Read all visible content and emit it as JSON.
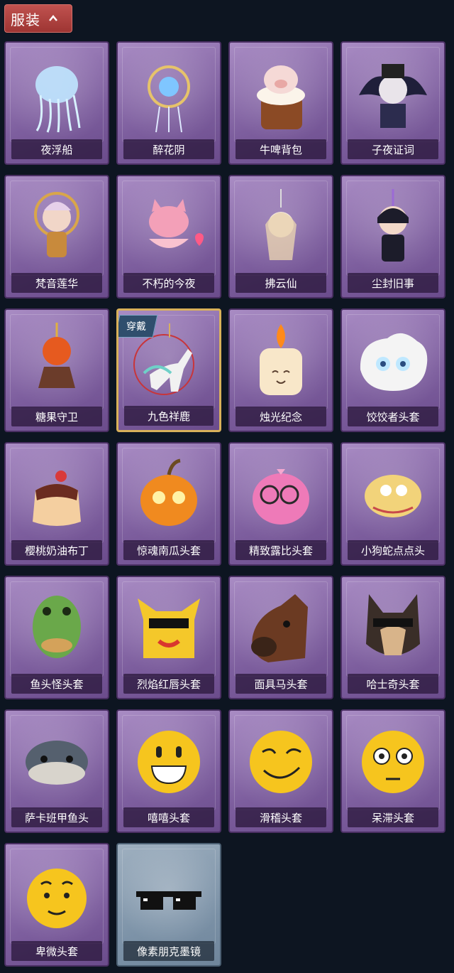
{
  "section": {
    "title": "服装"
  },
  "items": [
    {
      "name": "夜浮船"
    },
    {
      "name": "醉花阴"
    },
    {
      "name": "牛啤背包"
    },
    {
      "name": "子夜证词"
    },
    {
      "name": "梵音莲华"
    },
    {
      "name": "不朽的今夜"
    },
    {
      "name": "拂云仙"
    },
    {
      "name": "尘封旧事"
    },
    {
      "name": "糖果守卫"
    },
    {
      "name": "九色祥鹿",
      "badge": "穿戴"
    },
    {
      "name": "烛光纪念"
    },
    {
      "name": "饺饺者头套"
    },
    {
      "name": "樱桃奶油布丁"
    },
    {
      "name": "惊魂南瓜头套"
    },
    {
      "name": "精致露比头套"
    },
    {
      "name": "小狗蛇点点头"
    },
    {
      "name": "鱼头怪头套"
    },
    {
      "name": "烈焰红唇头套"
    },
    {
      "name": "面具马头套"
    },
    {
      "name": "哈士奇头套"
    },
    {
      "name": "萨卡班甲鱼头"
    },
    {
      "name": "嘻嘻头套"
    },
    {
      "name": "滑稽头套"
    },
    {
      "name": "呆滞头套"
    },
    {
      "name": "卑微头套"
    },
    {
      "name": "像素朋克墨镜"
    }
  ]
}
